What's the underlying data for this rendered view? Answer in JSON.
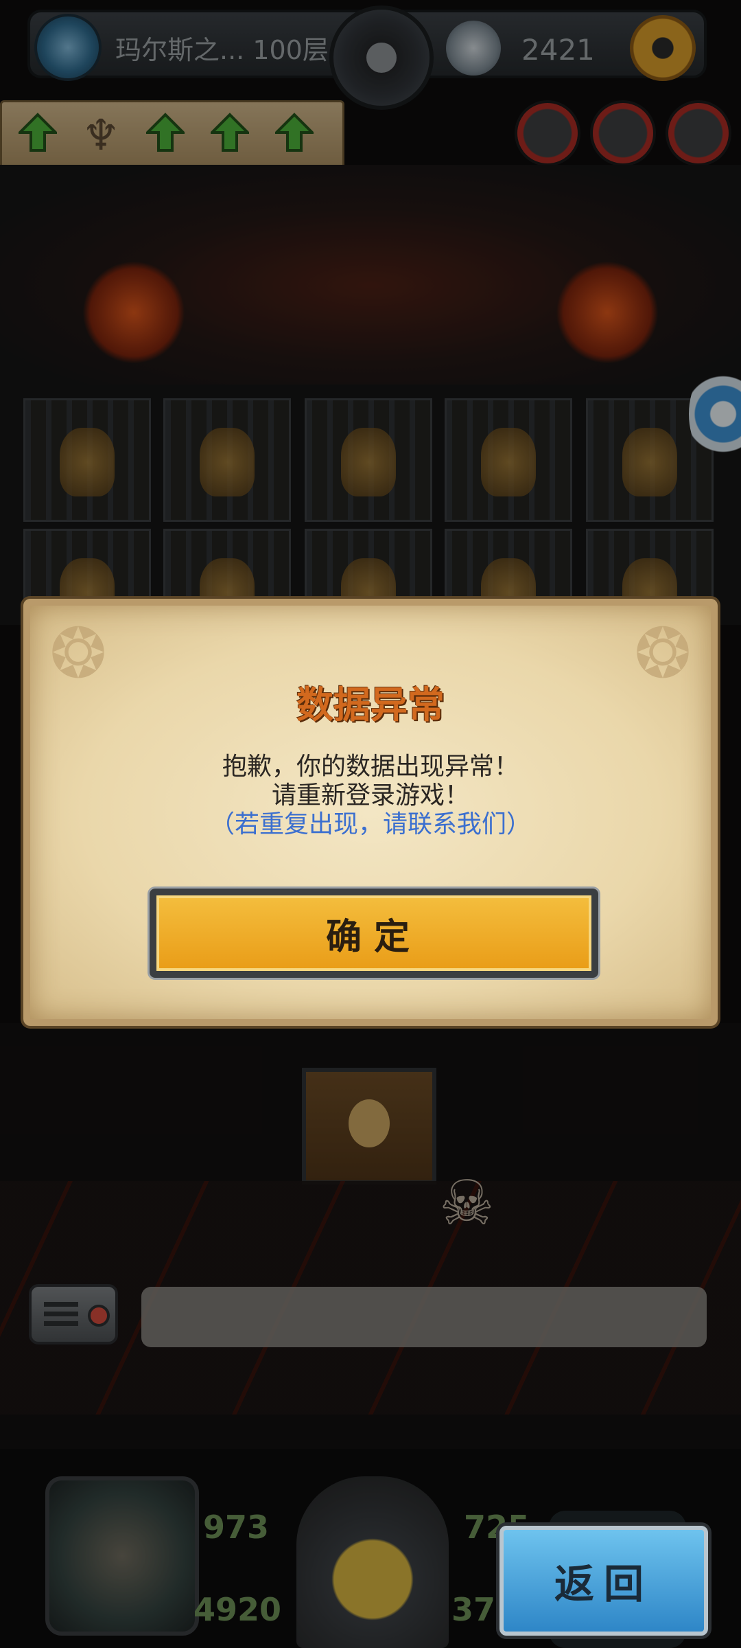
{
  "hud": {
    "floor_label": "玛尔斯之... 100层",
    "gold_value": "2421",
    "icons": [
      "portal-icon",
      "dial-icon",
      "wolf-icon",
      "gear-icon"
    ]
  },
  "buffs": {
    "icons": [
      "up-arrow-icon",
      "lamp-icon",
      "up-arrow-icon",
      "up-arrow-icon",
      "up-arrow-icon"
    ],
    "accent": "#4caf3a"
  },
  "stats": {
    "attack": "973",
    "hp": "4920",
    "defense": "725",
    "speed": "37"
  },
  "dialog": {
    "title": "数据异常",
    "line1": "抱歉，你的数据出现异常！",
    "line2": "请重新登录游戏！",
    "line3": "（若重复出现，请联系我们）",
    "confirm_label": "确定"
  },
  "footer": {
    "back_label": "返回"
  },
  "colors": {
    "title": "#d2691e",
    "hint": "#3b6fcf",
    "confirm": "#f0ad2a",
    "back": "#4aa6de"
  }
}
